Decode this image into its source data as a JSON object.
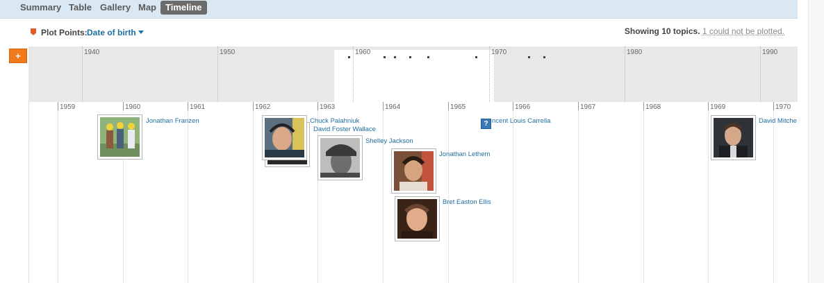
{
  "tabs": [
    {
      "label": "Summary",
      "active": false
    },
    {
      "label": "Table",
      "active": false
    },
    {
      "label": "Gallery",
      "active": false
    },
    {
      "label": "Map",
      "active": false
    },
    {
      "label": "Timeline",
      "active": true
    }
  ],
  "plot": {
    "label": "Plot Points:",
    "field": "Date of birth"
  },
  "status": {
    "showing": "Showing 10 topics.",
    "unplotted": "1 could not be plotted."
  },
  "zoom": {
    "label": "+"
  },
  "overview_years": [
    "1940",
    "1950",
    "1960",
    "1970",
    "1980",
    "1990"
  ],
  "detail_years": [
    "1959",
    "1960",
    "1961",
    "1962",
    "1963",
    "1964",
    "1965",
    "1966",
    "1967",
    "1968",
    "1969",
    "1970"
  ],
  "events": [
    {
      "name": "Jonathan Franzen"
    },
    {
      "name": "Chuck Palahniuk"
    },
    {
      "name": "David Foster Wallace"
    },
    {
      "name": "Shelley Jackson"
    },
    {
      "name": "Jonathan Lethem"
    },
    {
      "name": "Bret Easton Ellis"
    },
    {
      "name": "ncent Louis Carrella"
    },
    {
      "name": "David Mitche"
    }
  ],
  "unknown_icon": "?"
}
